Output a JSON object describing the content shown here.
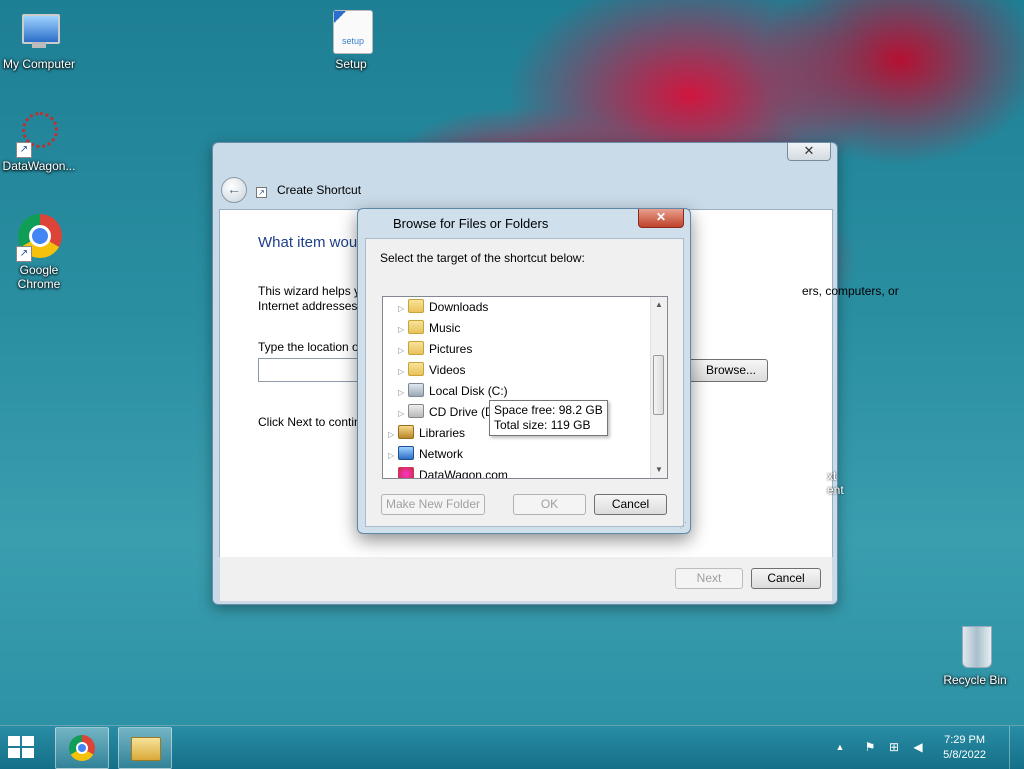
{
  "desktop": {
    "icons": [
      {
        "label": "My Computer"
      },
      {
        "label": "Setup",
        "badge": "setup"
      },
      {
        "label": "DataWagon..."
      },
      {
        "label": "Google Chrome"
      },
      {
        "label": "Recycle Bin"
      }
    ]
  },
  "wizard": {
    "title": "Create Shortcut",
    "close_glyph": "✕",
    "heading": "What item wou",
    "description": "This wizard helps yo",
    "description_line2": "Internet addresses.",
    "description_right": "ers, computers, or",
    "location_label": "Type the location of",
    "browse_label": "Browse...",
    "continue_text": "Click Next to contin",
    "next_label": "Next",
    "cancel_label": "Cancel",
    "side_peek_line1": "xt",
    "side_peek_line2": "ent"
  },
  "browse_dialog": {
    "title": "Browse for Files or Folders",
    "close_glyph": "✕",
    "instruction": "Select the target of the shortcut below:",
    "tree": [
      {
        "label": "Downloads",
        "icon": "folder-icon"
      },
      {
        "label": "Music",
        "icon": "folder-icon"
      },
      {
        "label": "Pictures",
        "icon": "folder-icon"
      },
      {
        "label": "Videos",
        "icon": "folder-icon"
      },
      {
        "label": "Local Disk (C:)",
        "icon": "disk-icon"
      },
      {
        "label": "CD Drive (D",
        "icon": "cd-icon"
      },
      {
        "label": "Libraries",
        "icon": "library-icon"
      },
      {
        "label": "Network",
        "icon": "network-icon"
      },
      {
        "label": "DataWagon.com",
        "icon": "datawagon-icon"
      }
    ],
    "tooltip": {
      "space_free": "Space free: 98.2 GB",
      "total_size": "Total size: 119 GB"
    },
    "make_new_folder_label": "Make New Folder",
    "ok_label": "OK",
    "cancel_label": "Cancel"
  },
  "taskbar": {
    "time": "7:29 PM",
    "date": "5/8/2022",
    "tray_up_glyph": "▲"
  }
}
